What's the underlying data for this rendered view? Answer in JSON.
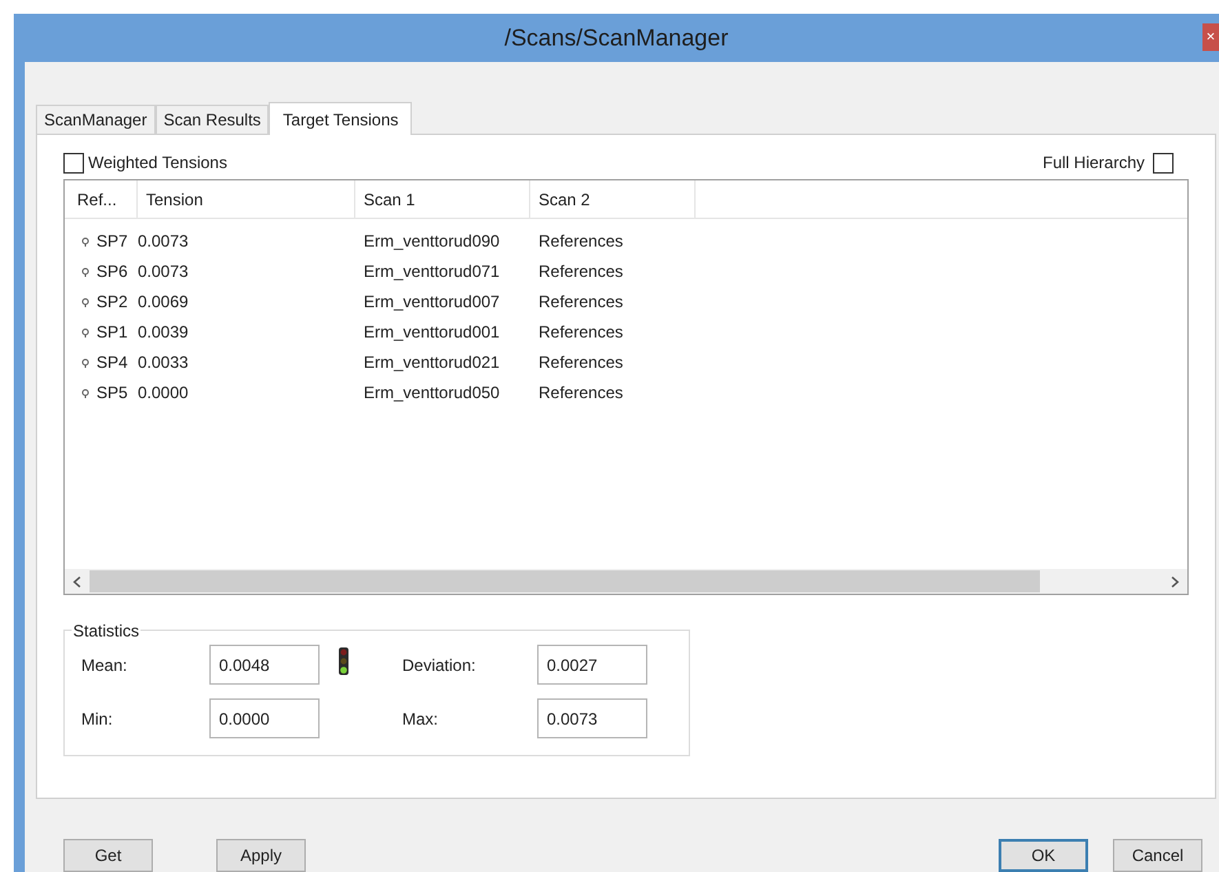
{
  "window": {
    "title": "/Scans/ScanManager",
    "close": "×"
  },
  "tabs": [
    {
      "label": "ScanManager",
      "selected": false
    },
    {
      "label": "Scan Results",
      "selected": false
    },
    {
      "label": "Target Tensions",
      "selected": true
    }
  ],
  "options": [
    {
      "label": "Weighted Tensions",
      "checked": false
    },
    {
      "label": "Full Hierarchy",
      "checked": false
    }
  ],
  "table": {
    "columns": [
      "Ref...",
      "Tension",
      "Scan 1",
      "Scan 2"
    ],
    "rows": [
      {
        "ref": "SP7",
        "tension": "0.0073",
        "scan_1": "Erm_venttorud090",
        "scan_2": "References"
      },
      {
        "ref": "SP6",
        "tension": "0.0073",
        "scan_1": "Erm_venttorud071",
        "scan_2": "References"
      },
      {
        "ref": "SP2",
        "tension": "0.0069",
        "scan_1": "Erm_venttorud007",
        "scan_2": "References"
      },
      {
        "ref": "SP1",
        "tension": "0.0039",
        "scan_1": "Erm_venttorud001",
        "scan_2": "References"
      },
      {
        "ref": "SP4",
        "tension": "0.0033",
        "scan_1": "Erm_venttorud021",
        "scan_2": "References"
      },
      {
        "ref": "SP5",
        "tension": "0.0000",
        "scan_1": "Erm_venttorud050",
        "scan_2": "References"
      }
    ]
  },
  "statistics": {
    "title": "Statistics",
    "fields": [
      {
        "label": "Mean:",
        "value": "0.0048"
      },
      {
        "label": "Deviation:",
        "value": "0.0027"
      },
      {
        "label": "Min:",
        "value": "0.0000"
      },
      {
        "label": "Max:",
        "value": "0.0073"
      }
    ]
  },
  "buttons": {
    "left": [
      "Get",
      "Apply"
    ],
    "right": [
      {
        "label": "OK",
        "selected": true
      },
      {
        "label": "Cancel",
        "selected": false
      }
    ]
  }
}
